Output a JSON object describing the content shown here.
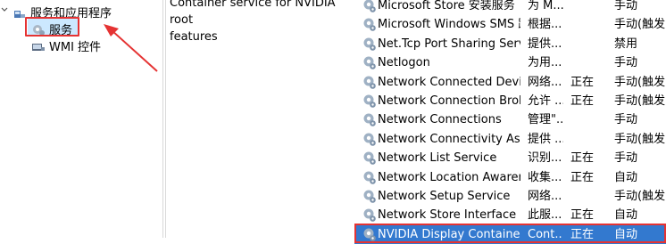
{
  "tree": {
    "services_and_apps": "服务和应用程序",
    "services": "服务",
    "wmi": "WMI 控件"
  },
  "description": {
    "line1": "Container service for NVIDIA root",
    "line2": "features"
  },
  "services": [
    {
      "name": "Microsoft Store 安装服务",
      "desc": "为 M...",
      "status": "",
      "startup": "手动"
    },
    {
      "name": "Microsoft Windows SMS 路...",
      "desc": "根据...",
      "status": "",
      "startup": "手动(触发..."
    },
    {
      "name": "Net.Tcp Port Sharing Service",
      "desc": "提供...",
      "status": "",
      "startup": "禁用"
    },
    {
      "name": "Netlogon",
      "desc": "为用...",
      "status": "",
      "startup": "手动"
    },
    {
      "name": "Network Connected Devic...",
      "desc": "网络...",
      "status": "正在",
      "startup": "手动(触发..."
    },
    {
      "name": "Network Connection Broker",
      "desc": "允许 ...",
      "status": "正在",
      "startup": "手动(触发..."
    },
    {
      "name": "Network Connections",
      "desc": "管理\"...",
      "status": "",
      "startup": "手动"
    },
    {
      "name": "Network Connectivity Assis...",
      "desc": "提供 ...",
      "status": "",
      "startup": "手动(触发..."
    },
    {
      "name": "Network List Service",
      "desc": "识别...",
      "status": "正在",
      "startup": "手动"
    },
    {
      "name": "Network Location Awarene",
      "desc": "收集...",
      "status": "正在",
      "startup": "自动"
    },
    {
      "name": "Network Setup Service",
      "desc": "网络...",
      "status": "",
      "startup": "手动(触发..."
    },
    {
      "name": "Network Store Interface Se...",
      "desc": "此服...",
      "status": "正在",
      "startup": "自动"
    },
    {
      "name": "NVIDIA Display Container LS",
      "desc": "Cont...",
      "status": "正在",
      "startup": "自动"
    }
  ],
  "colors": {
    "highlight": "#e53333",
    "selected_row": "#3379cf",
    "tree_selected": "#cce8ff"
  },
  "icons": {
    "service": "gear-icon",
    "tree_folder": "services-apps-icon",
    "wmi": "wmi-icon"
  }
}
